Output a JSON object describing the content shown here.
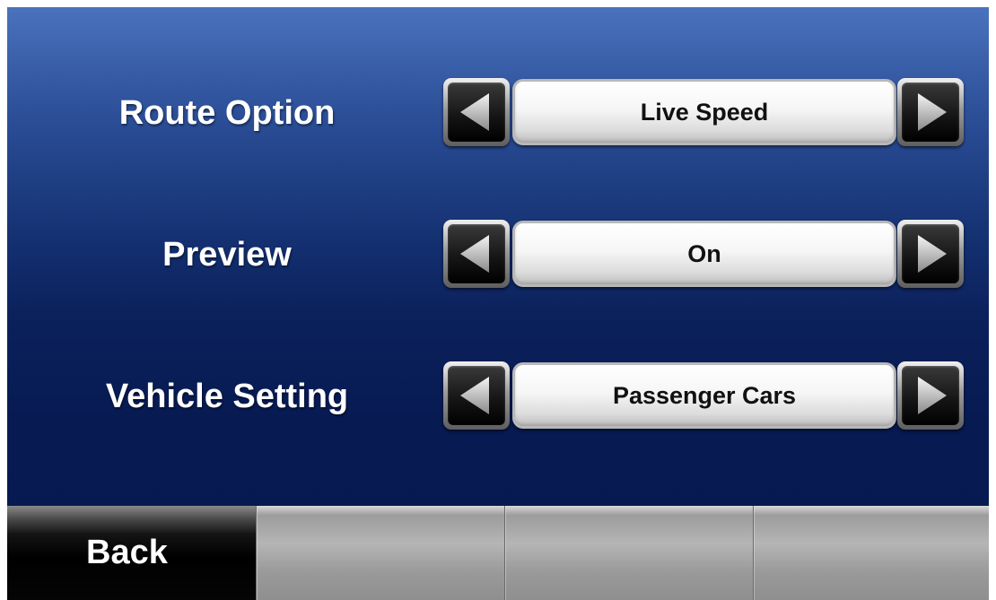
{
  "settings": [
    {
      "label": "Route Option",
      "value": "Live Speed"
    },
    {
      "label": "Preview",
      "value": "On"
    },
    {
      "label": "Vehicle Setting",
      "value": "Passenger Cars"
    }
  ],
  "controls": {
    "prev_icon": "triangle-left-icon",
    "next_icon": "triangle-right-icon"
  },
  "bottom_bar": {
    "back_label": "Back"
  },
  "colors": {
    "background_top": "#4a72bd",
    "background_bottom": "#061a50",
    "label_text": "#ffffff",
    "value_text": "#111111"
  }
}
